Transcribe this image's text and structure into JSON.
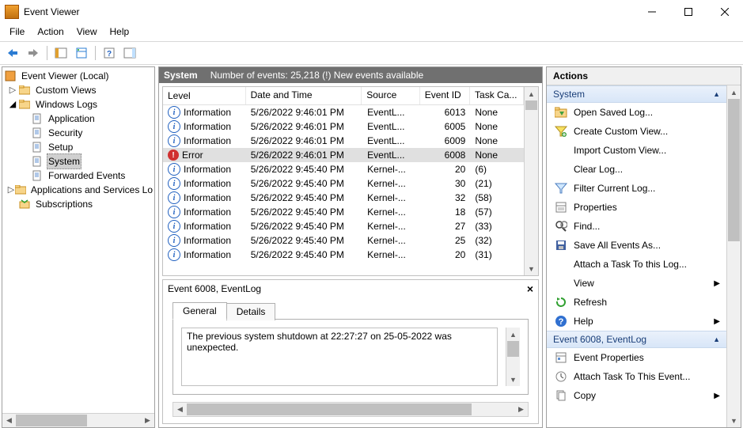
{
  "title": "Event Viewer",
  "menu": [
    "File",
    "Action",
    "View",
    "Help"
  ],
  "tree": {
    "root": "Event Viewer (Local)",
    "custom_views": "Custom Views",
    "windows_logs": "Windows Logs",
    "wl": {
      "application": "Application",
      "security": "Security",
      "setup": "Setup",
      "system": "System",
      "forwarded": "Forwarded Events"
    },
    "apps_services": "Applications and Services Lo",
    "subscriptions": "Subscriptions"
  },
  "listheader": {
    "logname": "System",
    "summary": "Number of events: 25,218 (!) New events available"
  },
  "cols": {
    "level": "Level",
    "date": "Date and Time",
    "source": "Source",
    "eventid": "Event ID",
    "task": "Task Ca..."
  },
  "rows": [
    {
      "icon": "info",
      "level": "Information",
      "date": "5/26/2022 9:46:01 PM",
      "src": "EventL...",
      "id": "6013",
      "task": "None",
      "sel": false
    },
    {
      "icon": "info",
      "level": "Information",
      "date": "5/26/2022 9:46:01 PM",
      "src": "EventL...",
      "id": "6005",
      "task": "None",
      "sel": false
    },
    {
      "icon": "info",
      "level": "Information",
      "date": "5/26/2022 9:46:01 PM",
      "src": "EventL...",
      "id": "6009",
      "task": "None",
      "sel": false
    },
    {
      "icon": "error",
      "level": "Error",
      "date": "5/26/2022 9:46:01 PM",
      "src": "EventL...",
      "id": "6008",
      "task": "None",
      "sel": true
    },
    {
      "icon": "info",
      "level": "Information",
      "date": "5/26/2022 9:45:40 PM",
      "src": "Kernel-...",
      "id": "20",
      "task": "(6)",
      "sel": false
    },
    {
      "icon": "info",
      "level": "Information",
      "date": "5/26/2022 9:45:40 PM",
      "src": "Kernel-...",
      "id": "30",
      "task": "(21)",
      "sel": false
    },
    {
      "icon": "info",
      "level": "Information",
      "date": "5/26/2022 9:45:40 PM",
      "src": "Kernel-...",
      "id": "32",
      "task": "(58)",
      "sel": false
    },
    {
      "icon": "info",
      "level": "Information",
      "date": "5/26/2022 9:45:40 PM",
      "src": "Kernel-...",
      "id": "18",
      "task": "(57)",
      "sel": false
    },
    {
      "icon": "info",
      "level": "Information",
      "date": "5/26/2022 9:45:40 PM",
      "src": "Kernel-...",
      "id": "27",
      "task": "(33)",
      "sel": false
    },
    {
      "icon": "info",
      "level": "Information",
      "date": "5/26/2022 9:45:40 PM",
      "src": "Kernel-...",
      "id": "25",
      "task": "(32)",
      "sel": false
    },
    {
      "icon": "info",
      "level": "Information",
      "date": "5/26/2022 9:45:40 PM",
      "src": "Kernel-...",
      "id": "20",
      "task": "(31)",
      "sel": false
    }
  ],
  "detail": {
    "title": "Event 6008, EventLog",
    "tabs": {
      "general": "General",
      "details": "Details"
    },
    "message": "The previous system shutdown at 22:27:27 on 25-05-2022 was unexpected."
  },
  "actions": {
    "title": "Actions",
    "group1": "System",
    "items1": [
      {
        "key": "open-saved-log",
        "label": "Open Saved Log...",
        "icon": "folder"
      },
      {
        "key": "create-custom-view",
        "label": "Create Custom View...",
        "icon": "funnel-plus"
      },
      {
        "key": "import-custom-view",
        "label": "Import Custom View...",
        "icon": ""
      },
      {
        "key": "clear-log",
        "label": "Clear Log...",
        "icon": ""
      },
      {
        "key": "filter-current-log",
        "label": "Filter Current Log...",
        "icon": "funnel"
      },
      {
        "key": "properties",
        "label": "Properties",
        "icon": "props"
      },
      {
        "key": "find",
        "label": "Find...",
        "icon": "find"
      },
      {
        "key": "save-all",
        "label": "Save All Events As...",
        "icon": "save"
      },
      {
        "key": "attach-task",
        "label": "Attach a Task To this Log...",
        "icon": ""
      },
      {
        "key": "view",
        "label": "View",
        "icon": "",
        "submenu": true
      },
      {
        "key": "refresh",
        "label": "Refresh",
        "icon": "refresh"
      },
      {
        "key": "help",
        "label": "Help",
        "icon": "help",
        "submenu": true
      }
    ],
    "group2": "Event 6008, EventLog",
    "items2": [
      {
        "key": "event-properties",
        "label": "Event Properties",
        "icon": "eprops"
      },
      {
        "key": "attach-task-event",
        "label": "Attach Task To This Event...",
        "icon": "attach"
      },
      {
        "key": "copy",
        "label": "Copy",
        "icon": "copy",
        "submenu": true
      }
    ]
  }
}
